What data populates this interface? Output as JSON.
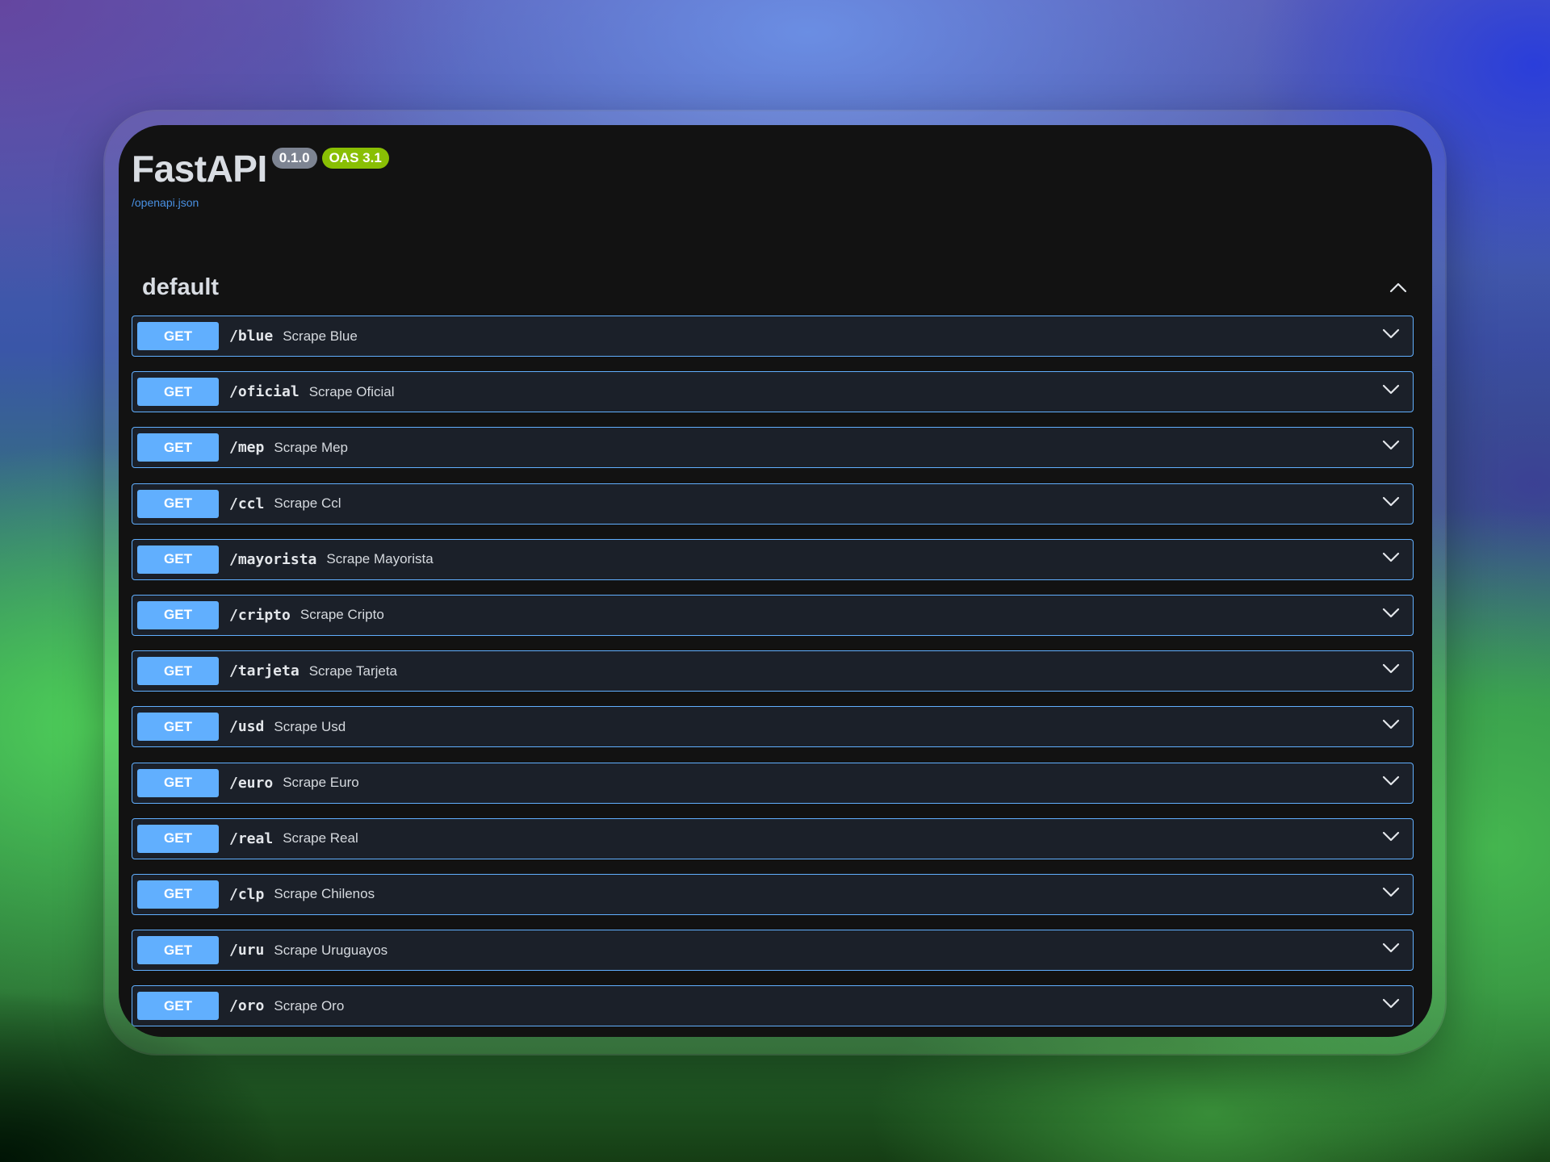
{
  "app": {
    "title": "FastAPI",
    "version_badge": "0.1.0",
    "oas_badge": "OAS 3.1",
    "spec_link": "/openapi.json"
  },
  "section": {
    "title": "default",
    "toggle_icon": "chevron-up-icon"
  },
  "colors": {
    "get_method": "#61affe",
    "panel_background": "#121212",
    "oas_badge": "#89bf04",
    "version_badge": "#7d8492"
  },
  "endpoints": [
    {
      "method": "GET",
      "path": "/blue",
      "summary": "Scrape Blue"
    },
    {
      "method": "GET",
      "path": "/oficial",
      "summary": "Scrape Oficial"
    },
    {
      "method": "GET",
      "path": "/mep",
      "summary": "Scrape Mep"
    },
    {
      "method": "GET",
      "path": "/ccl",
      "summary": "Scrape Ccl"
    },
    {
      "method": "GET",
      "path": "/mayorista",
      "summary": "Scrape Mayorista"
    },
    {
      "method": "GET",
      "path": "/cripto",
      "summary": "Scrape Cripto"
    },
    {
      "method": "GET",
      "path": "/tarjeta",
      "summary": "Scrape Tarjeta"
    },
    {
      "method": "GET",
      "path": "/usd",
      "summary": "Scrape Usd"
    },
    {
      "method": "GET",
      "path": "/euro",
      "summary": "Scrape Euro"
    },
    {
      "method": "GET",
      "path": "/real",
      "summary": "Scrape Real"
    },
    {
      "method": "GET",
      "path": "/clp",
      "summary": "Scrape Chilenos"
    },
    {
      "method": "GET",
      "path": "/uru",
      "summary": "Scrape Uruguayos"
    },
    {
      "method": "GET",
      "path": "/oro",
      "summary": "Scrape Oro"
    }
  ]
}
